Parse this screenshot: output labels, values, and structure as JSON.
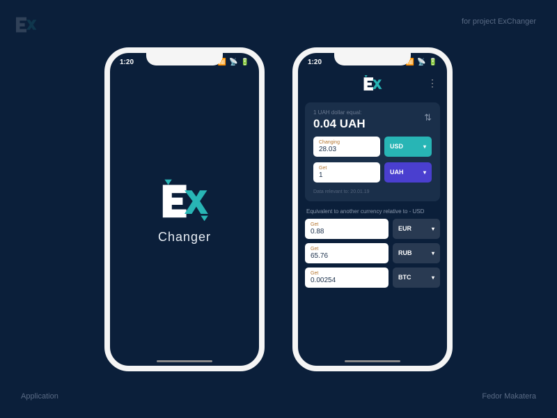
{
  "meta": {
    "top_right": "for project ExChanger",
    "bottom_left": "Application",
    "bottom_right": "Fedor Makatera"
  },
  "status": {
    "time": "1:20",
    "signal": "•••",
    "wifi": "⏚",
    "battery": "▮"
  },
  "splash": {
    "app_name": "Changer"
  },
  "exchange": {
    "rate_label": "1 UAH dollar equal:",
    "rate_value": "0.04 UAH",
    "changing": {
      "label": "Changing",
      "value": "28.03",
      "currency": "USD"
    },
    "get": {
      "label": "Get",
      "value": "1",
      "currency": "UAH"
    },
    "data_note": "Data relevant to: 20.01.19",
    "equiv_label": "Equivalent to another currency relative to - USD",
    "equivalents": [
      {
        "label": "Get",
        "value": "0.88",
        "currency": "EUR"
      },
      {
        "label": "Get",
        "value": "65.76",
        "currency": "RUB"
      },
      {
        "label": "Get",
        "value": "0.00254",
        "currency": "BTC"
      }
    ]
  }
}
